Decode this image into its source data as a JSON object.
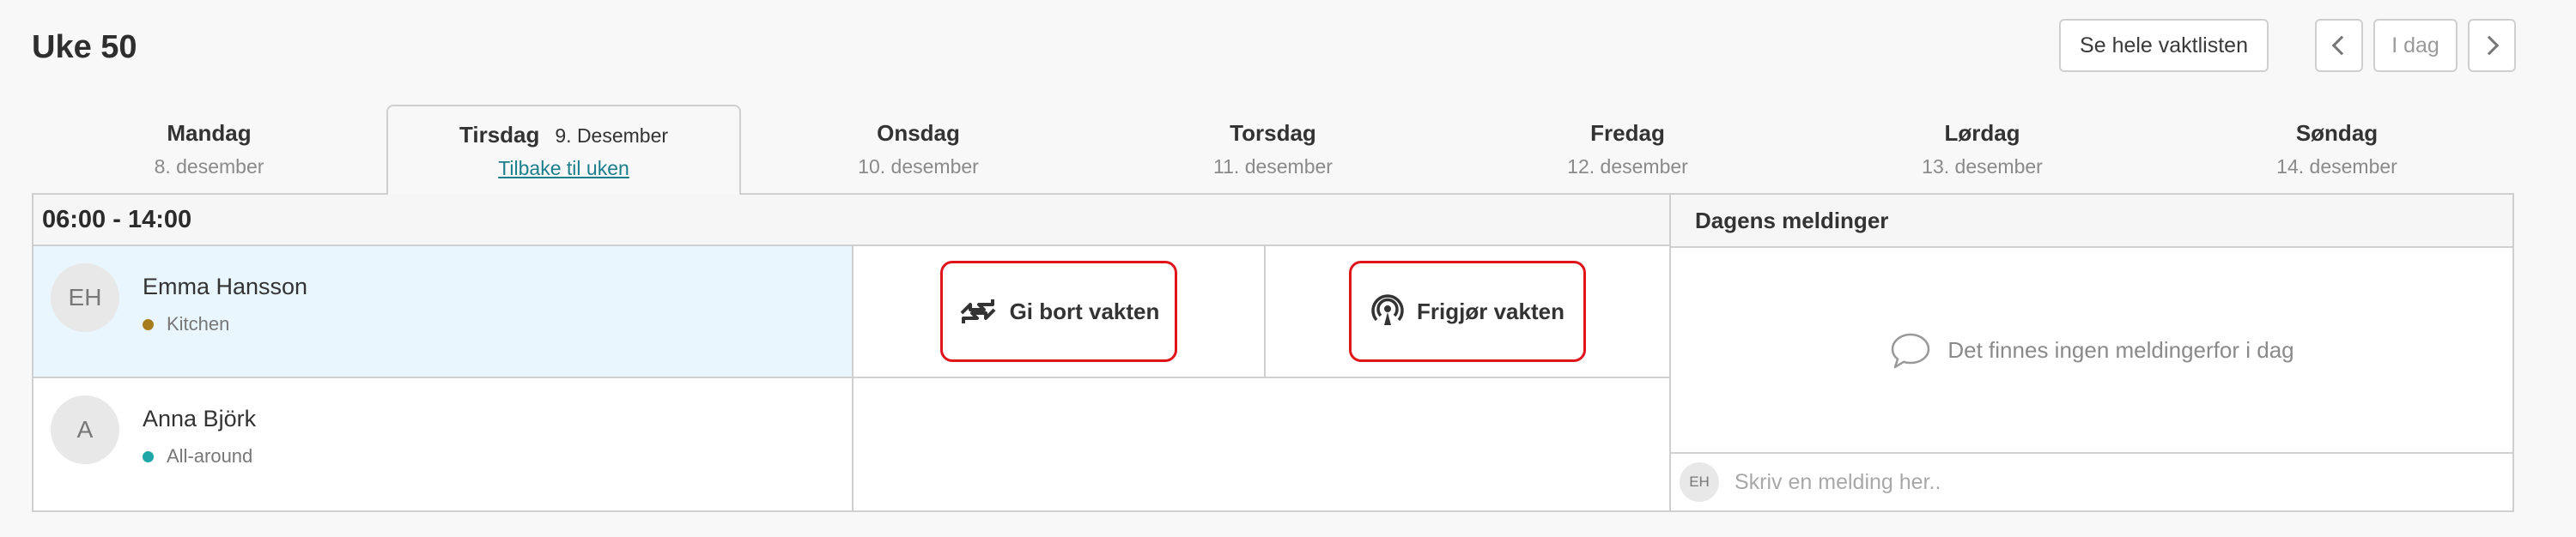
{
  "header": {
    "title": "Uke 50"
  },
  "toolbar": {
    "full_list_label": "Se hele vaktlisten",
    "today_label": "I dag"
  },
  "days": [
    {
      "name": "Mandag",
      "date": "8. desember"
    },
    {
      "name": "Tirsdag",
      "date": "9. Desember",
      "back_label": "Tilbake til uken"
    },
    {
      "name": "Onsdag",
      "date": "10. desember"
    },
    {
      "name": "Torsdag",
      "date": "11. desember"
    },
    {
      "name": "Fredag",
      "date": "12. desember"
    },
    {
      "name": "Lørdag",
      "date": "13. desember"
    },
    {
      "name": "Søndag",
      "date": "14. desember"
    }
  ],
  "shift": {
    "time": "06:00 - 14:00",
    "employees": [
      {
        "initials": "EH",
        "name": "Emma Hansson",
        "role": "Kitchen",
        "role_color": "#a67c1e"
      },
      {
        "initials": "A",
        "name": "Anna Björk",
        "role": "All-around",
        "role_color": "#1fa7a7"
      }
    ],
    "actions": {
      "give_away": "Gi bort vakten",
      "release": "Frigjør vakten"
    }
  },
  "messages": {
    "title": "Dagens meldinger",
    "empty_text": "Det finnes ingen meldingerfor i dag",
    "compose_initials": "EH",
    "compose_placeholder": "Skriv en melding her.."
  }
}
